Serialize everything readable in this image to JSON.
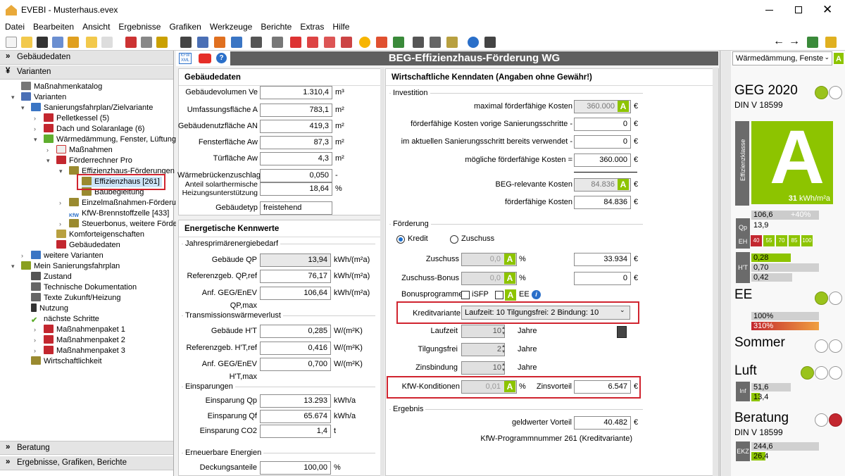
{
  "window": {
    "title": "EVEBI - Musterhaus.evex"
  },
  "menu": [
    "Datei",
    "Bearbeiten",
    "Ansicht",
    "Ergebnisse",
    "Grafiken",
    "Werkzeuge",
    "Berichte",
    "Extras",
    "Hilfe"
  ],
  "left": {
    "sections": {
      "gebaeudedaten": "Gebäudedaten",
      "varianten": "Varianten",
      "beratung": "Beratung",
      "ergebnisse": "Ergebnisse, Grafiken, Berichte"
    },
    "tree": [
      "Maßnahmenkatalog",
      "Varianten",
      "Sanierungsfahrplan/Zielvariante",
      "Pelletkessel (5)",
      "Dach und Solaranlage (6)",
      "Wärmedämmung, Fenster, Lüftungs",
      "Maßnahmen",
      "Förderrechner Pro",
      "Effizienzhaus-Förderungen",
      "Effizienzhaus [261]",
      "Baubegleitung",
      "Einzelmaßnahmen-Förderun",
      "KfW-Brennstoffzelle [433]",
      "Steuerbonus, weitere Förde",
      "Komforteigenschaften",
      "Gebäudedaten",
      "weitere Varianten",
      "Mein Sanierungsfahrplan",
      "Zustand",
      "Technische Dokumentation",
      "Texte Zukunft/Heizung",
      "Nutzung",
      "nächste Schritte",
      "Maßnahmenpaket 1",
      "Maßnahmenpaket 2",
      "Maßnahmenpaket 3",
      "Wirtschaftlichkeit"
    ]
  },
  "main": {
    "title": "BEG-Effizienzhaus-Förderung WG",
    "geb": {
      "title": "Gebäudedaten",
      "rows": [
        {
          "l": "Gebäudevolumen Ve",
          "v": "1.310,4",
          "u": "m³"
        },
        {
          "l": "Umfassungsfläche A",
          "v": "783,1",
          "u": "m²"
        },
        {
          "l": "Gebäudenutzfläche AN",
          "v": "419,3",
          "u": "m²"
        },
        {
          "l": "Fensterfläche Aw",
          "v": "87,3",
          "u": "m²"
        },
        {
          "l": "Türfläche Aw",
          "v": "4,3",
          "u": "m²"
        },
        {
          "l": "Wärmebrückenzuschlag",
          "v": "0,050",
          "u": "-"
        },
        {
          "l": "Anteil solarthermische Heizungsunterstützung",
          "v": "18,64",
          "u": "%"
        },
        {
          "l": "Gebäudetyp",
          "v": "freistehend",
          "u": ""
        }
      ]
    },
    "ek": {
      "title": "Energetische Kennwerte",
      "g1": "Jahresprimärenergiebedarf",
      "g1rows": [
        {
          "l": "Gebäude QP",
          "v": "13,94",
          "u": "kWh/(m²a)"
        },
        {
          "l": "Referenzgeb. QP,ref",
          "v": "76,17",
          "u": "kWh/(m²a)"
        },
        {
          "l": "Anf. GEG/EnEV QP,max",
          "v": "106,64",
          "u": "kWh/(m²a)"
        }
      ],
      "g2": "Transmissionswärmeverlust",
      "g2rows": [
        {
          "l": "Gebäude H'T",
          "v": "0,285",
          "u": "W/(m²K)"
        },
        {
          "l": "Referenzgeb. H'T,ref",
          "v": "0,416",
          "u": "W/(m²K)"
        },
        {
          "l": "Anf. GEG/EnEV H'T,max",
          "v": "0,700",
          "u": "W/(m²K)"
        }
      ],
      "g3": "Einsparungen",
      "g3rows": [
        {
          "l": "Einsparung Qp",
          "v": "13.293",
          "u": "kWh/a"
        },
        {
          "l": "Einsparung Qf",
          "v": "65.674",
          "u": "kWh/a"
        },
        {
          "l": "Einsparung CO2",
          "v": "1,4",
          "u": "t"
        }
      ],
      "g4": "Erneuerbare Energien",
      "g4rows": [
        {
          "l": "Deckungsanteile",
          "v": "100,00",
          "u": "%"
        }
      ]
    },
    "wk": {
      "title": "Wirtschaftliche Kenndaten (Angaben ohne Gewähr!)",
      "inv": "Investition",
      "invrows": [
        {
          "l": "maximal förderfähige Kosten",
          "v": "360.000"
        },
        {
          "l": "förderfähige Kosten vorige Sanierungsschritte -",
          "v": "0"
        },
        {
          "l": "im aktuellen Sanierungsschritt bereits verwendet -",
          "v": "0"
        },
        {
          "l": "mögliche förderfähige Kosten =",
          "v": "360.000"
        },
        {
          "l": "BEG-relevante Kosten",
          "v": "84.836"
        },
        {
          "l": "förderfähige Kosten",
          "v": "84.836"
        }
      ],
      "foe": "Förderung",
      "kredit": "Kredit",
      "zuschuss": "Zuschuss",
      "zuschussL": "Zuschuss",
      "zuschussV": "0,0",
      "zuschussR": "33.934",
      "bonusL": "Zuschuss-Bonus",
      "bonusV": "0,0",
      "bonusR": "0",
      "bonusprog": "Bonusprogramme",
      "isfp": "iSFP",
      "ee": "EE",
      "kvL": "Kreditvariante",
      "kvV": "Laufzeit: 10 Tilgungsfrei: 2 Bindung: 10",
      "laufzeitL": "Laufzeit",
      "laufzeitV": "10",
      "tilgL": "Tilgungsfrei",
      "tilgV": "2",
      "zinsL": "Zinsbindung",
      "zinsV": "10",
      "jahre": "Jahre",
      "kondL": "KfW-Konditionen",
      "kondV": "0,01",
      "zinsvL": "Zinsvorteil",
      "zinsvV": "6.547",
      "erg": "Ergebnis",
      "gwL": "geldwerter Vorteil",
      "gwV": "40.482",
      "prog": "KfW-Programmnummer 261 (Kreditvariante)",
      "euro": "€",
      "pct": "%",
      "a": "A"
    }
  },
  "right": {
    "dropdown": "Wärmedämmung, Fenste",
    "geg": "GEG 2020",
    "din": "DIN V 18599",
    "klasse": "A",
    "kwh": "31",
    "kwhU": "kWh/m²a",
    "effz": "Effizienzklasse",
    "qp1": "106,6",
    "qp1b": "+40%",
    "qp2": "13,9",
    "qpL": "Qp",
    "eh": [
      "40",
      "55",
      "70",
      "85",
      "100"
    ],
    "ehL": "EH",
    "ht": [
      "0,28",
      "0,70",
      "0,42"
    ],
    "htL": "H'T",
    "ee": "EE",
    "ee1": "100%",
    "ee2": "310%",
    "sommer": "Sommer",
    "luft": "Luft",
    "inf1": "51,6",
    "inf2": "13,4",
    "infL": "Inf min",
    "beratung": "Beratung",
    "din2": "DIN V 18599",
    "ekz1": "244,6",
    "ekz2": "26,4",
    "ekzL": "EKZ"
  }
}
